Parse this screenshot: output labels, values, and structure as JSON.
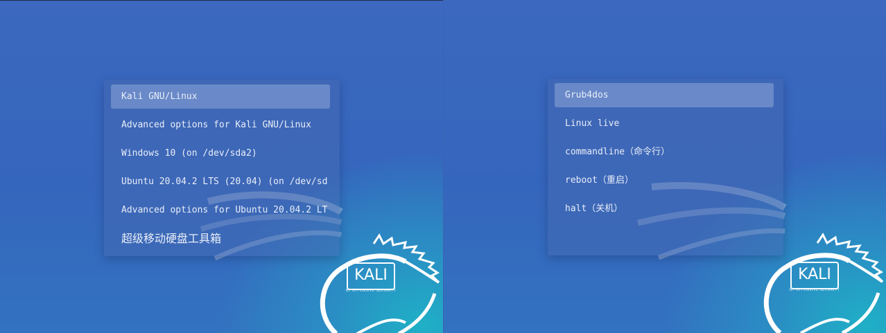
{
  "left_menu": {
    "items": [
      "Kali GNU/Linux",
      "Advanced options for Kali GNU/Linux",
      "Windows 10 (on /dev/sda2)",
      "Ubuntu 20.04.2 LTS (20.04) (on /dev/sd",
      "Advanced options for Ubuntu 20.04.2 LT",
      "超级移动硬盘工具箱"
    ],
    "selected_index": 0
  },
  "right_menu": {
    "items": [
      "Grub4dos",
      "Linux live",
      "commandline（命令行）",
      "reboot（重启）",
      "halt（关机）"
    ],
    "selected_index": 0
  },
  "branding": {
    "logo_text": "KALI",
    "tagline": "BY OFFENSIVE SECURITY"
  }
}
